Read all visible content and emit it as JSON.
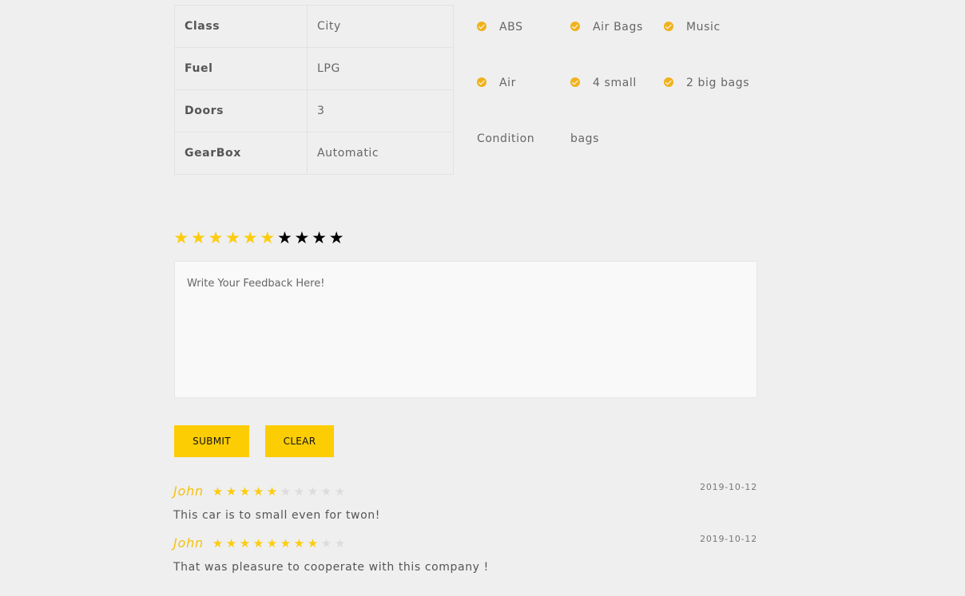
{
  "specs": [
    {
      "label": "Class",
      "value": "City"
    },
    {
      "label": "Fuel",
      "value": "LPG"
    },
    {
      "label": "Doors",
      "value": "3"
    },
    {
      "label": "GearBox",
      "value": "Automatic"
    }
  ],
  "features": [
    {
      "label": "ABS",
      "continuation": ""
    },
    {
      "label": "Air Bags",
      "continuation": ""
    },
    {
      "label": "Music",
      "continuation": ""
    },
    {
      "label": "Air",
      "continuation": "Condition"
    },
    {
      "label": "4 small",
      "continuation": "bags"
    },
    {
      "label": "2 big bags",
      "continuation": ""
    }
  ],
  "rating_input": {
    "value": 6,
    "max": 10,
    "star_glyph": "★",
    "on_color": "#fdcc0d",
    "off_color": "#000000"
  },
  "feedback": {
    "placeholder": "Write Your Feedback Here!",
    "value": ""
  },
  "buttons": {
    "submit": "SUBMIT",
    "clear": "CLEAR"
  },
  "reviews": [
    {
      "author": "John",
      "rating": 5,
      "max": 10,
      "date": "2019-10-12",
      "text": "This car is to small even for twon!"
    },
    {
      "author": "John",
      "rating": 8,
      "max": 10,
      "date": "2019-10-12",
      "text": "That was pleasure to cooperate with this company !"
    }
  ],
  "colors": {
    "accent": "#fdcd04",
    "author": "#f6c10e",
    "check": "#f0b21c",
    "background": "#efefef"
  },
  "icons": {
    "feature_check": "check-circle-icon",
    "star": "star-icon"
  }
}
